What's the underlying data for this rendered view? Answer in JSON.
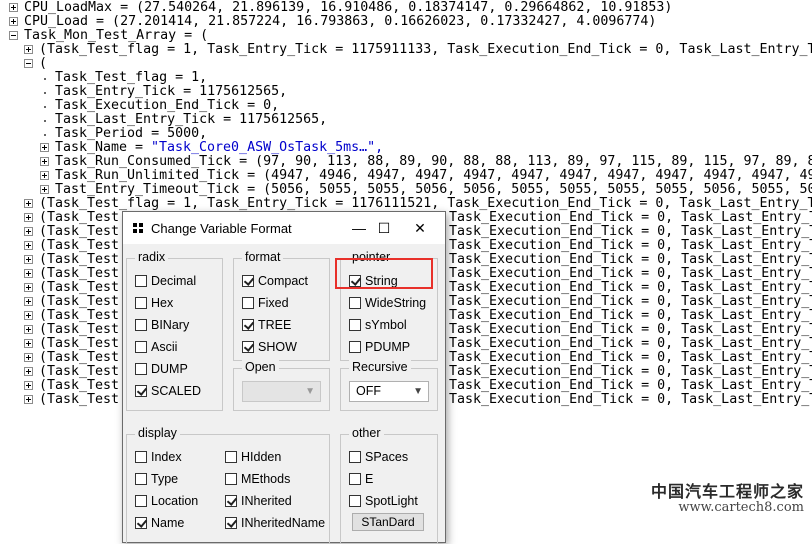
{
  "tree": {
    "rows": [
      {
        "text": "CPU_LoadMax = (27.540264, 21.896139, 16.910486, 0.18374147, 0.29664862, 10.91853)",
        "blue": ""
      },
      {
        "text": "CPU_Load = (27.201414, 21.857224, 16.793863, 0.16626023, 0.17332427, 4.0096774)",
        "blue": ""
      },
      {
        "text": "Task_Mon_Test_Array = (",
        "blue": ""
      },
      {
        "text": "(Task_Test_flag = 1, Task_Entry_Tick = 1175911133, Task_Execution_End_Tick = 0, Task_Last_Entry_Ti",
        "blue": ""
      },
      {
        "text": "(",
        "blue": ""
      },
      {
        "text": "Task_Test_flag = 1,",
        "blue": ""
      },
      {
        "text": "Task_Entry_Tick = 1175612565,",
        "blue": ""
      },
      {
        "text": "Task_Execution_End_Tick = 0,",
        "blue": ""
      },
      {
        "text": "Task_Last_Entry_Tick = 1175612565,",
        "blue": ""
      },
      {
        "text": "Task_Period = 5000,",
        "blue": ""
      },
      {
        "text": "Task_Name = ",
        "blue": "\"Task_Core0_ASW_OsTask_5ms…\","
      },
      {
        "text": "Task_Run_Consumed_Tick = (97, 90, 113, 88, 89, 90, 88, 88, 113, 89, 97, 115, 89, 115, 97, 89, 8",
        "blue": ""
      },
      {
        "text": "Task_Run_Unlimited_Tick = (4947, 4946, 4947, 4947, 4947, 4947, 4947, 4947, 4947, 4947, 4947, 49",
        "blue": ""
      },
      {
        "text": "Tast_Entry_Timeout_Tick = (5056, 5055, 5055, 5056, 5056, 5055, 5055, 5055, 5055, 5056, 5055, 50",
        "blue": ""
      },
      {
        "text": "(Task_Test_flag = 1, Task_Entry_Tick = 1176111521, Task_Execution_End_Tick = 0, Task_Last_Entry_Ti",
        "blue": ""
      },
      {
        "text": "(Task_Test",
        "tail": "Task_Execution_End_Tick = 0, Task_Last_Entry_Ti"
      },
      {
        "text": "(Task_Test",
        "tail": "Task_Execution_End_Tick = 0, Task_Last_Entry_Ti"
      },
      {
        "text": "(Task_Test",
        "tail": "Task_Execution_End_Tick = 0, Task_Last_Entry_Ti"
      },
      {
        "text": "(Task_Test",
        "tail": "Task_Execution_End_Tick = 0, Task_Last_Entry_Ti"
      },
      {
        "text": "(Task_Test",
        "tail": "Task_Execution_End_Tick = 0, Task_Last_Entry_Ti"
      },
      {
        "text": "(Task_Test",
        "tail": "Task_Execution_End_Tick = 0, Task_Last_Entry_Ti"
      },
      {
        "text": "(Task_Test",
        "tail": "Task_Execution_End_Tick = 0, Task_Last_Entry_Ti"
      },
      {
        "text": "(Task_Test",
        "tail": "Task_Execution_End_Tick = 0, Task_Last_Entry_Ti"
      },
      {
        "text": "(Task_Test",
        "tail": "Task_Execution_End_Tick = 0, Task_Last_Entry_Ti"
      },
      {
        "text": "(Task_Test",
        "tail": "Task_Execution_End_Tick = 0, Task_Last_Entry_Ti"
      },
      {
        "text": "(Task_Test",
        "tail": "Task_Execution_End_Tick = 0, Task_Last_Entry_Ti"
      },
      {
        "text": "(Task_Test",
        "tail": "Task_Execution_End_Tick = 0, Task_Last_Entry_Ti"
      },
      {
        "text": "(Task_Test",
        "tail": "Task_Execution_End_Tick = 0, Task_Last_Entry_Ti"
      },
      {
        "text": "(Task_Test",
        "tail": "Task_Execution_End_Tick = 0, Task_Last_Entry_Ti"
      }
    ]
  },
  "dialog": {
    "title": "Change Variable Format",
    "window_buttons": {
      "minimize": "—",
      "maximize": "☐",
      "close": "✕"
    },
    "radix": {
      "label": "radix",
      "options": [
        {
          "label": "Decimal",
          "checked": false
        },
        {
          "label": "Hex",
          "checked": false
        },
        {
          "label": "BINary",
          "checked": false
        },
        {
          "label": "Ascii",
          "checked": false
        },
        {
          "label": "DUMP",
          "checked": false
        },
        {
          "label": "SCALED",
          "checked": true
        }
      ]
    },
    "format": {
      "label": "format",
      "options": [
        {
          "label": "Compact",
          "checked": true
        },
        {
          "label": "Fixed",
          "checked": false
        },
        {
          "label": "TREE",
          "checked": true
        },
        {
          "label": "SHOW",
          "checked": true
        }
      ],
      "open_label": "Open",
      "open_value": ""
    },
    "pointer": {
      "label": "pointer",
      "options": [
        {
          "label": "String",
          "checked": true
        },
        {
          "label": "WideString",
          "checked": false
        },
        {
          "label": "sYmbol",
          "checked": false
        },
        {
          "label": "PDUMP",
          "checked": false
        }
      ],
      "recursive_label": "Recursive",
      "recursive_value": "OFF"
    },
    "display": {
      "label": "display",
      "options": [
        {
          "label": "Index",
          "checked": false
        },
        {
          "label": "HIdden",
          "checked": false
        },
        {
          "label": "Type",
          "checked": false
        },
        {
          "label": "MEthods",
          "checked": false
        },
        {
          "label": "Location",
          "checked": false
        },
        {
          "label": "INherited",
          "checked": true
        },
        {
          "label": "Name",
          "checked": true
        },
        {
          "label": "INheritedName",
          "checked": true
        }
      ]
    },
    "other": {
      "label": "other",
      "options": [
        {
          "label": "SPaces",
          "checked": false
        },
        {
          "label": "E",
          "checked": false
        },
        {
          "label": "SpotLight",
          "checked": false
        }
      ],
      "standard_label": "STanDard"
    }
  },
  "watermark": {
    "line1": "中国汽车工程师之家",
    "line2": "www.cartech8.com"
  },
  "colors": {
    "highlight": "#e8302a",
    "string_value": "#0000cc"
  }
}
